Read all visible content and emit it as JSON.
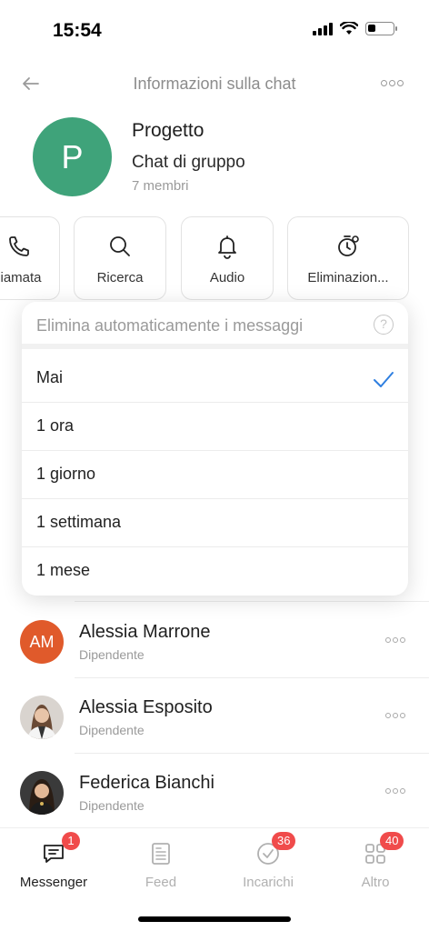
{
  "status_bar": {
    "time": "15:54",
    "battery_level": 0.3
  },
  "header": {
    "title": "Informazioni sulla chat",
    "back_icon": "arrow-left-icon",
    "more_icon": "more-horizontal-icon"
  },
  "group": {
    "avatar_letter": "P",
    "avatar_color": "#3fa37a",
    "name": "Progetto",
    "type": "Chat di gruppo",
    "members": "7 membri"
  },
  "actions": [
    {
      "label": "iamata",
      "icon": "phone-icon"
    },
    {
      "label": "Ricerca",
      "icon": "search-icon"
    },
    {
      "label": "Audio",
      "icon": "bell-icon"
    },
    {
      "label": "Eliminazion...",
      "icon": "timer-icon"
    }
  ],
  "auto_delete_popup": {
    "title": "Elimina automaticamente i messaggi",
    "help_icon": "help-icon",
    "options": [
      {
        "label": "Mai",
        "selected": true
      },
      {
        "label": "1 ora",
        "selected": false
      },
      {
        "label": "1 giorno",
        "selected": false
      },
      {
        "label": "1 settimana",
        "selected": false
      },
      {
        "label": "1 mese",
        "selected": false
      }
    ],
    "accent_color": "#2f7fe0"
  },
  "members": [
    {
      "initials": "AM",
      "name": "Alessia Marrone",
      "role": "Dipendente"
    },
    {
      "initials": "",
      "name": "Alessia Esposito",
      "role": "Dipendente"
    },
    {
      "initials": "",
      "name": "Federica Bianchi",
      "role": "Dipendente"
    }
  ],
  "tabbar": {
    "tabs": [
      {
        "label": "Messenger",
        "icon": "chat-icon",
        "badge": "1",
        "active": true
      },
      {
        "label": "Feed",
        "icon": "newspaper-icon",
        "badge": "",
        "active": false
      },
      {
        "label": "Incarichi",
        "icon": "check-circle-icon",
        "badge": "36",
        "active": false
      },
      {
        "label": "Altro",
        "icon": "grid-icon",
        "badge": "40",
        "active": false
      }
    ],
    "badge_color": "#f04b4b"
  }
}
